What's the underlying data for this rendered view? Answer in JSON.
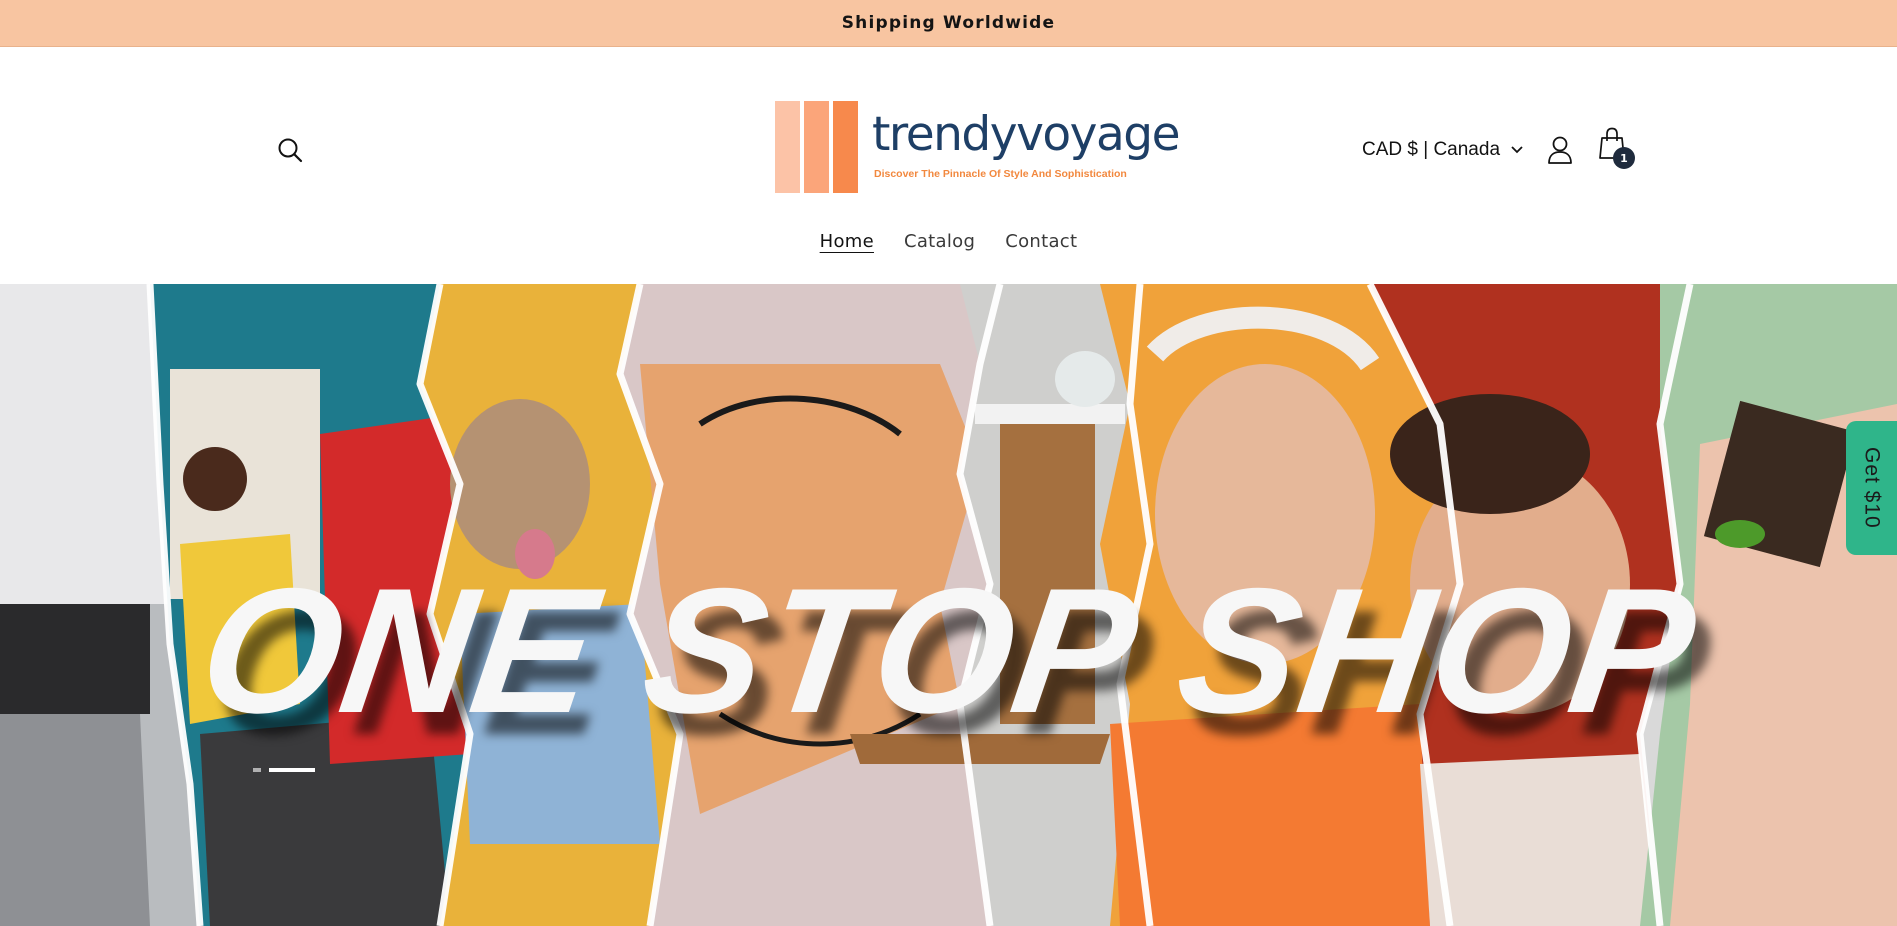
{
  "announcement": {
    "text": "Shipping Worldwide"
  },
  "header": {
    "logo": {
      "name": "trendyvoyage",
      "tagline": "Discover The Pinnacle Of Style And Sophistication"
    },
    "country_selector": {
      "value": "CAD $ | Canada"
    },
    "cart": {
      "count": "1"
    }
  },
  "nav": {
    "items": [
      {
        "label": "Home",
        "active": true
      },
      {
        "label": "Catalog",
        "active": false
      },
      {
        "label": "Contact",
        "active": false
      }
    ]
  },
  "hero": {
    "title": "ONE STOP SHOP",
    "slides": 2,
    "active_slide": 2
  },
  "promo_tab": {
    "label": "Get $10"
  },
  "colors": {
    "announcement_bg": "#f8c5a1",
    "logo_text": "#1e3f66",
    "logo_accent": "#f2883e",
    "promo_bg": "#2fb58a",
    "cart_badge": "#1f2b3d"
  },
  "icons": [
    "search-icon",
    "user-icon",
    "shopping-bag-icon",
    "chevron-down-icon"
  ]
}
